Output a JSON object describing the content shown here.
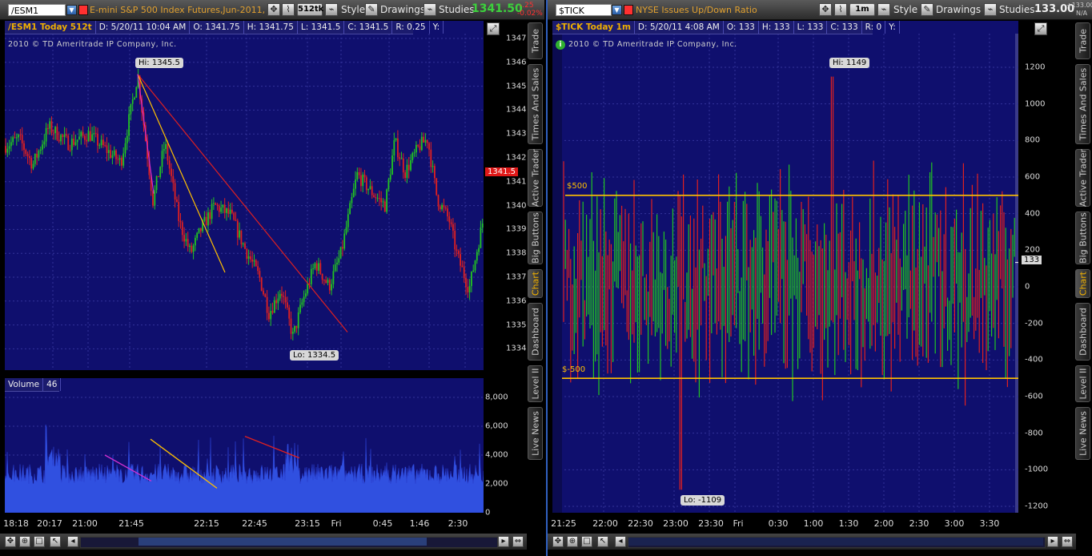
{
  "left": {
    "toolbar": {
      "symbol": "/ESM1",
      "description": "E-mini S&P 500 Index Futures,Jun-2011,ETH",
      "aggregation": "512tk",
      "style_label": "Style",
      "drawings_label": "Drawings",
      "studies_label": "Studies",
      "last_price": "1341.50",
      "net_change": "-.25",
      "pct_change": "-0.02%"
    },
    "infobar": {
      "title": "/ESM1 Today 512t",
      "date": "D: 5/20/11 10:04 AM",
      "open": "O: 1341.75",
      "high": "H: 1341.75",
      "low": "L: 1341.5",
      "close": "C: 1341.5",
      "range": "R: 0.25",
      "y": "Y:"
    },
    "copyright": "2010 © TD Ameritrade IP Company, Inc.",
    "hi_label": "Hi: 1345.5",
    "lo_label": "Lo: 1334.5",
    "current_price_tag": "1341.5",
    "y_labels": [
      "1347",
      "1346",
      "1345",
      "1344",
      "1343",
      "1342",
      "1341",
      "1340",
      "1339",
      "1338",
      "1337",
      "1336",
      "1335",
      "1334"
    ],
    "volume_title": "Volume",
    "volume_value": "46",
    "volume_labels": [
      "8,000",
      "6,000",
      "4,000",
      "2,000",
      "0"
    ],
    "x_labels": [
      "18:18",
      "20:17",
      "21:00",
      "21:45",
      "22:15",
      "22:45",
      "23:15",
      "Fri",
      "0:45",
      "1:46",
      "2:30"
    ]
  },
  "right": {
    "toolbar": {
      "symbol": "$TICK",
      "description": "NYSE Issues Up/Down Ratio",
      "aggregation": "1m",
      "style_label": "Style",
      "drawings_label": "Drawings",
      "studies_label": "Studies",
      "last_price": "133.00",
      "net_change": "+133.00",
      "pct_change": "N/A"
    },
    "infobar": {
      "title": "$TICK Today 1m",
      "date": "D: 5/20/11 4:08 AM",
      "open": "O: 133",
      "high": "H: 133",
      "low": "L: 133",
      "close": "C: 133",
      "range": "R: 0",
      "y": "Y:"
    },
    "copyright": "2010 © TD Ameritrade IP Company, Inc.",
    "hi_label": "Hi: 1149",
    "lo_label": "Lo: -1109",
    "current_price_tag": "133",
    "line_upper_label": "$500",
    "line_lower_label": "$-500",
    "y_labels": [
      "1200",
      "1000",
      "800",
      "600",
      "400",
      "200",
      "0",
      "-200",
      "-400",
      "-600",
      "-800",
      "-1000",
      "-1200"
    ],
    "x_labels": [
      "21:25",
      "22:00",
      "22:30",
      "23:00",
      "23:30",
      "Fri",
      "0:30",
      "1:00",
      "1:30",
      "2:00",
      "2:30",
      "3:00",
      "3:30"
    ]
  },
  "side_tabs": [
    "Trade",
    "Times And Sales",
    "Active Trader",
    "Big Buttons",
    "Chart",
    "Dashboard",
    "Level II",
    "Live News"
  ],
  "active_tab": "Chart",
  "colors": {
    "chart_bg": "#0f0f6e",
    "up": "#22c422",
    "down": "#e02020",
    "volume": "#3050e0",
    "orange_line": "#ffc000",
    "accent": "#f0b000"
  }
}
